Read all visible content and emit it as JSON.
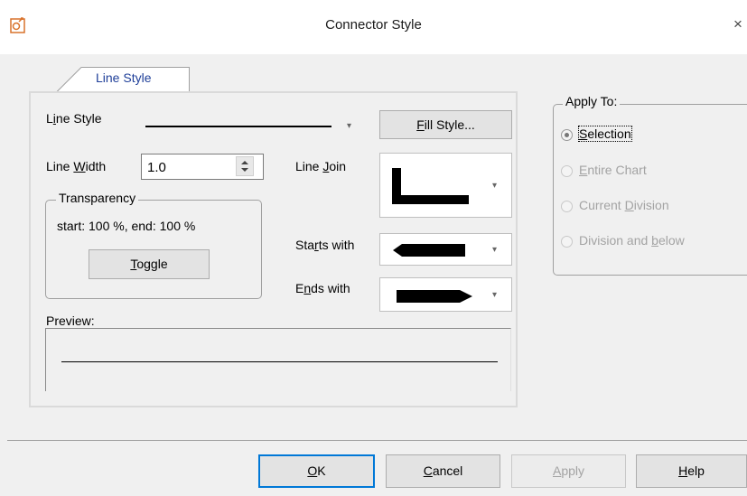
{
  "window": {
    "title": "Connector Style",
    "close_glyph": "×"
  },
  "tabs": [
    {
      "label": "Line Style",
      "selected": true
    }
  ],
  "line_style": {
    "line_style_label": "Line Style",
    "line_style_label_pre": "L",
    "line_style_label_hot": "i",
    "line_style_label_post": "ne Style",
    "fill_style_button_hot": "F",
    "fill_style_button_post": "ill Style...",
    "line_width_label_pre": "Line ",
    "line_width_label_hot": "W",
    "line_width_label_post": "idth",
    "line_width_value": "1.0",
    "line_join_label_pre": "Line ",
    "line_join_label_hot": "J",
    "line_join_label_post": "oin",
    "starts_with_label_pre": "Sta",
    "starts_with_label_hot": "r",
    "starts_with_label_post": "ts with",
    "ends_with_label_pre": "E",
    "ends_with_label_hot": "n",
    "ends_with_label_post": "ds with",
    "transparency_legend": "Transparency",
    "transparency_text": "start: 100 %, end: 100 %",
    "toggle_button_hot": "T",
    "toggle_button_post": "oggle",
    "preview_label": "Preview:"
  },
  "apply_to": {
    "legend": "Apply To:",
    "options": [
      {
        "pre": "",
        "hot": "S",
        "post": "election",
        "selected": true,
        "enabled": true
      },
      {
        "pre": "",
        "hot": "E",
        "post": "ntire Chart",
        "selected": false,
        "enabled": false
      },
      {
        "pre": "Current ",
        "hot": "D",
        "post": "ivision",
        "selected": false,
        "enabled": false
      },
      {
        "pre": "Division and ",
        "hot": "b",
        "post": "elow",
        "selected": false,
        "enabled": false
      }
    ]
  },
  "buttons": {
    "ok_hot": "O",
    "ok_post": "K",
    "cancel_hot": "C",
    "cancel_post": "ancel",
    "apply_hot": "A",
    "apply_post": "pply",
    "help_hot": "H",
    "help_post": "elp"
  },
  "colors": {
    "tab_text": "#1f3f99",
    "default_button_border": "#0078d7",
    "disabled_text": "#a3a3a3"
  }
}
